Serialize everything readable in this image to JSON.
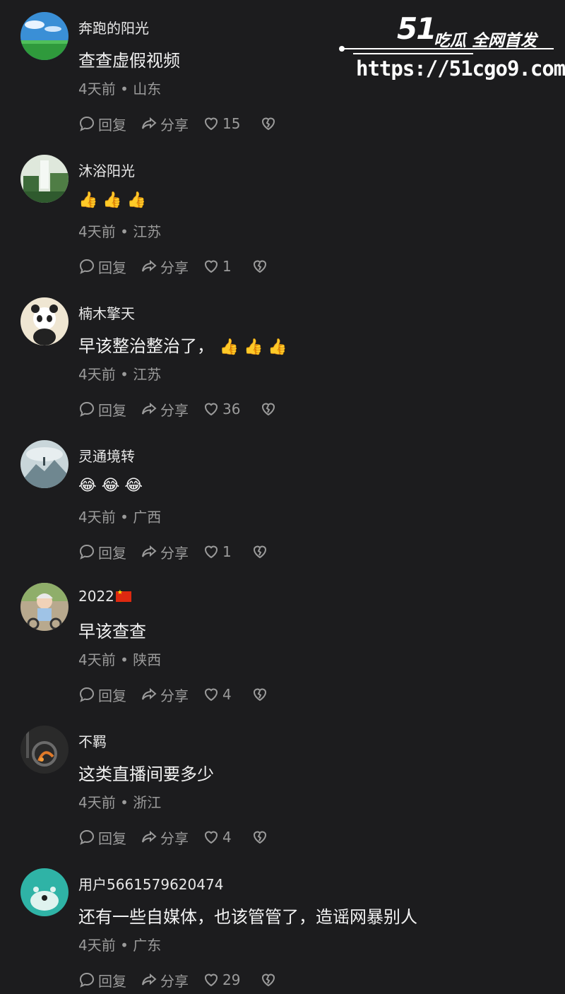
{
  "watermark": {
    "logo": "51",
    "tagline": "吃瓜 全网首发",
    "url": "https://51cgo9.com"
  },
  "actions": {
    "reply": "回复",
    "share": "分享"
  },
  "comments": [
    {
      "username": "奔跑的阳光",
      "content": "查查虚假视频",
      "time": "4天前",
      "location": "山东",
      "likes": "15"
    },
    {
      "username": "沐浴阳光",
      "content": "",
      "time": "4天前",
      "location": "江苏",
      "likes": "1",
      "emoji": "👍 👍 👍"
    },
    {
      "username": "楠木擎天",
      "content": "早该整治整治了，",
      "time": "4天前",
      "location": "江苏",
      "likes": "36",
      "emoji": "👍 👍 👍"
    },
    {
      "username": "灵通境转",
      "content": "",
      "time": "4天前",
      "location": "广西",
      "likes": "1",
      "emoji": "😂 😂 😂"
    },
    {
      "username": "2022",
      "content": "早该查查",
      "time": "4天前",
      "location": "陕西",
      "likes": "4"
    },
    {
      "username": "不羁",
      "content": "这类直播间要多少",
      "time": "4天前",
      "location": "浙江",
      "likes": "4"
    },
    {
      "username": "用户5661579620474",
      "content": "还有一些自媒体，也该管管了，造谣网暴别人",
      "time": "4天前",
      "location": "广东",
      "likes": "29"
    }
  ]
}
